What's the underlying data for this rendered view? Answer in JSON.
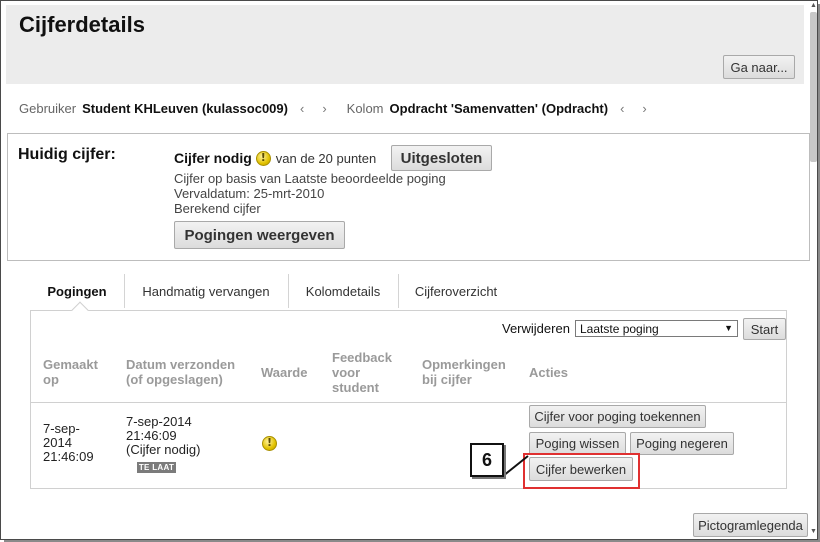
{
  "page": {
    "title": "Cijferdetails",
    "go_to_label": "Ga naar..."
  },
  "breadcrumb": {
    "user_label": "Gebruiker",
    "user_value": "Student KHLeuven (kulassoc009)",
    "column_label": "Kolom",
    "column_value": "Opdracht 'Samenvatten' (Opdracht)",
    "prev_icon": "‹",
    "next_icon": "›"
  },
  "current_grade": {
    "label": "Huidig cijfer:",
    "status": "Cijfer nodig",
    "out_of": "van de 20 punten",
    "excluded_button": "Uitgesloten",
    "info": [
      "Cijfer op basis van Laatste beoordeelde poging",
      "Vervaldatum: 25-mrt-2010",
      "Berekend cijfer"
    ],
    "view_attempts_button": "Pogingen weergeven"
  },
  "tabs": [
    {
      "label": "Pogingen",
      "active": true
    },
    {
      "label": "Handmatig vervangen",
      "active": false
    },
    {
      "label": "Kolomdetails",
      "active": false
    },
    {
      "label": "Cijferoverzicht",
      "active": false
    }
  ],
  "attempts": {
    "remove_label": "Verwijderen",
    "remove_selected": "Laatste poging",
    "start_button": "Start",
    "columns": [
      "Gemaakt op",
      "Datum verzonden (of opgeslagen)",
      "Waarde",
      "Feedback voor student",
      "Opmerkingen bij cijfer",
      "Acties"
    ],
    "rows": [
      {
        "made_on": "7-sep-2014 21:46:09",
        "submitted": "7-sep-2014 21:46:09",
        "submitted_note": "(Cijfer nodig)",
        "late_badge": "TE LAAT",
        "value_icon": "grade-needed-icon",
        "actions": {
          "assign": "Cijfer voor poging toekennen",
          "clear": "Poging wissen",
          "ignore": "Poging negeren",
          "edit": "Cijfer bewerken"
        }
      }
    ]
  },
  "callout": {
    "number": "6",
    "highlight_color": "#e03030"
  },
  "footer": {
    "legend_button": "Pictogramlegenda"
  }
}
